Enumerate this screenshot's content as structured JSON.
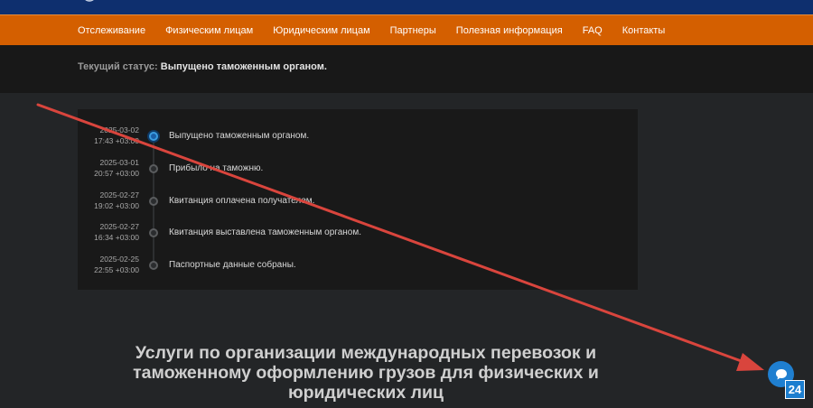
{
  "nav": {
    "items": [
      {
        "label": "Отслеживание"
      },
      {
        "label": "Физическим лицам"
      },
      {
        "label": "Юридическим лицам"
      },
      {
        "label": "Партнеры"
      },
      {
        "label": "Полезная информация"
      },
      {
        "label": "FAQ"
      },
      {
        "label": "Контакты"
      }
    ]
  },
  "status": {
    "label": "Текущий статус:",
    "value": "Выпущено таможенным органом."
  },
  "timeline": [
    {
      "date": "2025-03-02",
      "time": "17:43 +03:00",
      "text": "Выпущено таможенным органом.",
      "active": true
    },
    {
      "date": "2025-03-01",
      "time": "20:57 +03:00",
      "text": "Прибыло на таможню.",
      "active": false
    },
    {
      "date": "2025-02-27",
      "time": "19:02 +03:00",
      "text": "Квитанция оплачена получателем.",
      "active": false
    },
    {
      "date": "2025-02-27",
      "time": "16:34 +03:00",
      "text": "Квитанция выставлена таможенным органом.",
      "active": false
    },
    {
      "date": "2025-02-25",
      "time": "22:55 +03:00",
      "text": "Паспортные данные собраны.",
      "active": false
    }
  ],
  "headline": {
    "line1": "Услуги по организации международных перевозок и",
    "line2": "таможенному оформлению грузов для физических и",
    "line3": "юридических лиц"
  },
  "widget": {
    "badge": "24",
    "icon": "chat-bubble-icon"
  },
  "colors": {
    "nav_bg": "#d45f00",
    "topbar_bg": "#0e2f6e",
    "annotation_arrow": "#d9453d",
    "active_dot": "#3a9be0"
  }
}
